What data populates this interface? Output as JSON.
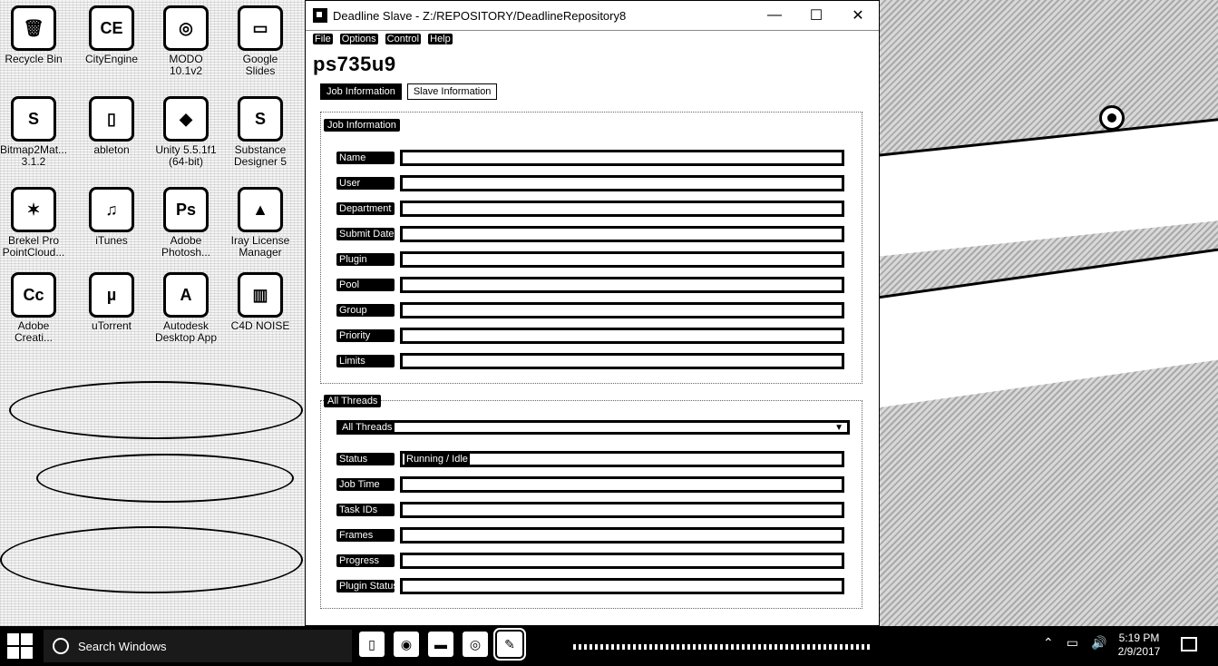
{
  "desktop_icons": [
    {
      "label": "Recycle Bin",
      "glyph": "🗑"
    },
    {
      "label": "CityEngine",
      "glyph": "CE"
    },
    {
      "label": "MODO 10.1v2",
      "glyph": "◎"
    },
    {
      "label": "Google Slides",
      "glyph": "▭"
    },
    {
      "label": "Bitmap2Mat... 3.1.2",
      "glyph": "S"
    },
    {
      "label": "ableton",
      "glyph": "▯"
    },
    {
      "label": "Unity 5.5.1f1 (64-bit)",
      "glyph": "◆"
    },
    {
      "label": "Substance Designer 5",
      "glyph": "S"
    },
    {
      "label": "Brekel Pro PointCloud...",
      "glyph": "✶"
    },
    {
      "label": "iTunes",
      "glyph": "♫"
    },
    {
      "label": "Adobe Photosh...",
      "glyph": "Ps"
    },
    {
      "label": "Iray License Manager",
      "glyph": "▲"
    },
    {
      "label": "Adobe Creati...",
      "glyph": "Cc"
    },
    {
      "label": "uTorrent",
      "glyph": "µ"
    },
    {
      "label": "Autodesk Desktop App",
      "glyph": "A"
    },
    {
      "label": "C4D NOISE",
      "glyph": "▥"
    }
  ],
  "window": {
    "title": "Deadline Slave - Z:/REPOSITORY/DeadlineRepository8",
    "minimize": "—",
    "maximize": "☐",
    "close": "✕",
    "menu": [
      "File",
      "Options",
      "Control",
      "Help"
    ],
    "hostname": "ps735u9",
    "tabs": [
      "Job Information",
      "Slave Information"
    ],
    "job_section_title": "Job Information",
    "job_fields": [
      {
        "label": "Name",
        "value": ""
      },
      {
        "label": "User",
        "value": ""
      },
      {
        "label": "Department",
        "value": ""
      },
      {
        "label": "Submit Date",
        "value": ""
      },
      {
        "label": "Plugin",
        "value": ""
      },
      {
        "label": "Pool",
        "value": ""
      },
      {
        "label": "Group",
        "value": ""
      },
      {
        "label": "Priority",
        "value": ""
      },
      {
        "label": "Limits",
        "value": ""
      }
    ],
    "threads_section_title": "All Threads",
    "threads_combo": "All Threads",
    "thread_fields": [
      {
        "label": "Status",
        "value": "Running / Idle"
      },
      {
        "label": "Job Time",
        "value": ""
      },
      {
        "label": "Task IDs",
        "value": ""
      },
      {
        "label": "Frames",
        "value": ""
      },
      {
        "label": "Progress",
        "value": ""
      },
      {
        "label": "Plugin Status",
        "value": ""
      }
    ]
  },
  "taskbar": {
    "search_placeholder": "Search Windows",
    "apps": [
      "▯",
      "◉",
      "▬",
      "◎",
      "✎"
    ],
    "tray_icons": [
      "⌃",
      "▭",
      "🔊"
    ],
    "time": "5:19 PM",
    "date": "2/9/2017"
  }
}
